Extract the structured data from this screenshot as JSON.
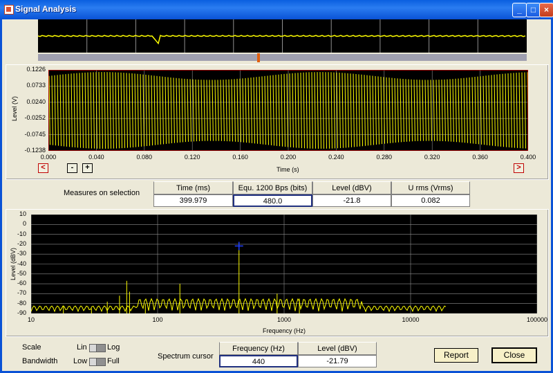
{
  "window": {
    "title": "Signal Analysis",
    "min": "_",
    "max": "□",
    "close": "×"
  },
  "colors": {
    "trace": "#ffff00",
    "grid": "#909090",
    "plot_bg": "#000000",
    "cursor": "#2040ff",
    "accent": "#c00000"
  },
  "time_plot": {
    "ylabel": "Level (V)",
    "xlabel": "Time (s)",
    "yticks": [
      "0.1226",
      "0.0733",
      "0.0240",
      "-0.0252",
      "-0.0745",
      "-0.1238"
    ],
    "xticks": [
      "0.000",
      "0.040",
      "0.080",
      "0.120",
      "0.160",
      "0.200",
      "0.240",
      "0.280",
      "0.320",
      "0.360",
      "0.400"
    ],
    "prev": "<",
    "next": ">",
    "zoom_out": "-",
    "zoom_in": "+"
  },
  "measures": {
    "label": "Measures on selection",
    "headers": [
      "Time (ms)",
      "Equ. 1200 Bps (bits)",
      "Level (dBV)",
      "U rms (Vrms)"
    ],
    "values": [
      "399.979",
      "480.0",
      "-21.8",
      "0.082"
    ]
  },
  "spectrum": {
    "ylabel": "Level (dBV)",
    "xlabel": "Frequency (Hz)",
    "yticks": [
      "10",
      "0",
      "-10",
      "-20",
      "-30",
      "-40",
      "-50",
      "-60",
      "-70",
      "-80",
      "-90"
    ],
    "xticks": [
      "10",
      "100",
      "1000",
      "10000",
      "100000"
    ]
  },
  "chart_data": [
    {
      "type": "line",
      "ylabel": "Level (V)",
      "xlabel": "Time (s)",
      "xlim": [
        0,
        0.4
      ],
      "ylim": [
        -0.1238,
        0.1226
      ]
    },
    {
      "type": "line",
      "ylabel": "Level (dBV)",
      "xlabel": "Frequency (Hz)",
      "xscale": "log",
      "xlim": [
        10,
        100000
      ],
      "ylim": [
        -90,
        10
      ],
      "x": [
        18,
        30,
        40,
        50,
        57,
        60,
        80,
        150,
        440,
        880,
        1320
      ],
      "y": [
        -82,
        -85,
        -78,
        -72,
        -57,
        -68,
        -80,
        -60,
        -21.79,
        -70,
        -75
      ]
    }
  ],
  "controls": {
    "scale_label": "Scale",
    "scale_lin": "Lin",
    "scale_log": "Log",
    "bandwidth_label": "Bandwidth",
    "bw_low": "Low",
    "bw_full": "Full",
    "cursor_label": "Spectrum cursor",
    "cursor_headers": [
      "Frequency (Hz)",
      "Level (dBV)"
    ],
    "cursor_values": [
      "440",
      "-21.79"
    ],
    "report": "Report",
    "close": "Close"
  }
}
